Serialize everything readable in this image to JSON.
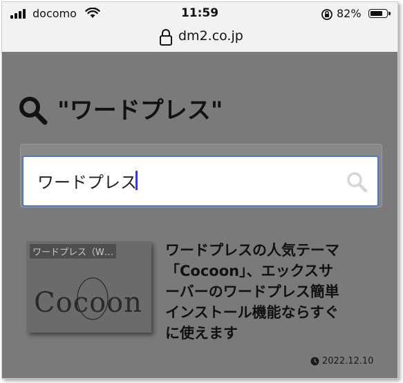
{
  "status": {
    "carrier": "docomo",
    "time": "11:59",
    "battery_percent": "82%",
    "battery_level": 0.82
  },
  "browser": {
    "url": "dm2.co.jp"
  },
  "search": {
    "heading": "\"ワードプレス\"",
    "query": "ワードプレス",
    "icon": "search-icon"
  },
  "article": {
    "thumb_label": "ワードプレス（W…",
    "thumb_logo": "Cocoon",
    "title_lines": [
      "ワードプレスの人気テーマ",
      "「Cocoon」、エックスサ",
      "ーバーのワードプレス簡単",
      "インストール機能ならすぐ",
      "に使えます"
    ],
    "date": "2022.12.10"
  }
}
